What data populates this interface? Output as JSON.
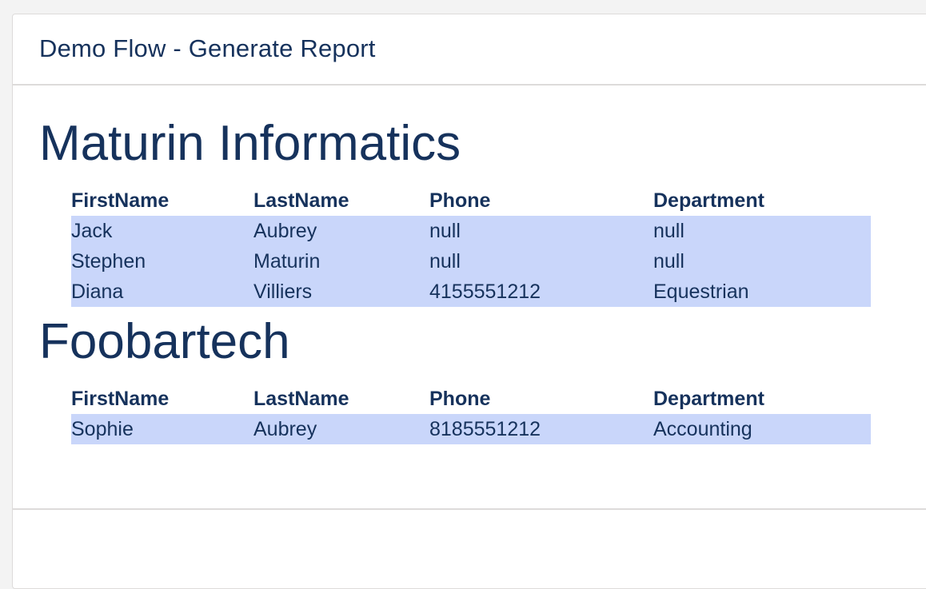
{
  "header": {
    "title": "Demo Flow - Generate Report"
  },
  "report": {
    "columns": [
      "FirstName",
      "LastName",
      "Phone",
      "Department"
    ],
    "companies": [
      {
        "name": "Maturin Informatics",
        "rows": [
          [
            "Jack",
            "Aubrey",
            "null",
            "null"
          ],
          [
            "Stephen",
            "Maturin",
            "null",
            "null"
          ],
          [
            "Diana",
            "Villiers",
            "4155551212",
            "Equestrian"
          ]
        ]
      },
      {
        "name": "Foobartech",
        "rows": [
          [
            "Sophie",
            "Aubrey",
            "8185551212",
            "Accounting"
          ]
        ]
      }
    ]
  },
  "colors": {
    "text": "#16325c",
    "row_highlight": "#c9d6fa",
    "border": "#dddbda"
  }
}
